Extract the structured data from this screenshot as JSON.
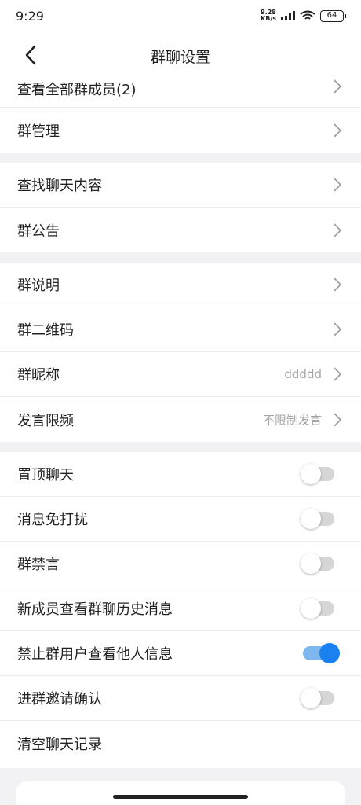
{
  "status_bar": {
    "time": "9:29",
    "net_speed": "9.28",
    "net_unit": "KB/s",
    "battery": "64"
  },
  "header": {
    "title": "群聊设置",
    "back": "chevron-left-icon"
  },
  "rows": {
    "members": {
      "label": "查看全部群成员(2)"
    },
    "manage": {
      "label": "群管理"
    },
    "search": {
      "label": "查找聊天内容"
    },
    "notice": {
      "label": "群公告"
    },
    "desc": {
      "label": "群说明"
    },
    "qrcode": {
      "label": "群二维码"
    },
    "nickname": {
      "label": "群昵称",
      "value": "ddddd"
    },
    "limit": {
      "label": "发言限频",
      "value": "不限制发言"
    },
    "pin": {
      "label": "置顶聊天",
      "on": false
    },
    "mute": {
      "label": "消息免打扰",
      "on": false
    },
    "ban": {
      "label": "群禁言",
      "on": false
    },
    "history": {
      "label": "新成员查看群聊历史消息",
      "on": false
    },
    "privacy": {
      "label": "禁止群用户查看他人信息",
      "on": true
    },
    "invite": {
      "label": "进群邀请确认",
      "on": false
    },
    "clear": {
      "label": "清空聊天记录"
    }
  },
  "colors": {
    "accent": "#1a82f0",
    "toggle_off": "#cfcfcf",
    "divider_band": "#f2f2f4"
  }
}
